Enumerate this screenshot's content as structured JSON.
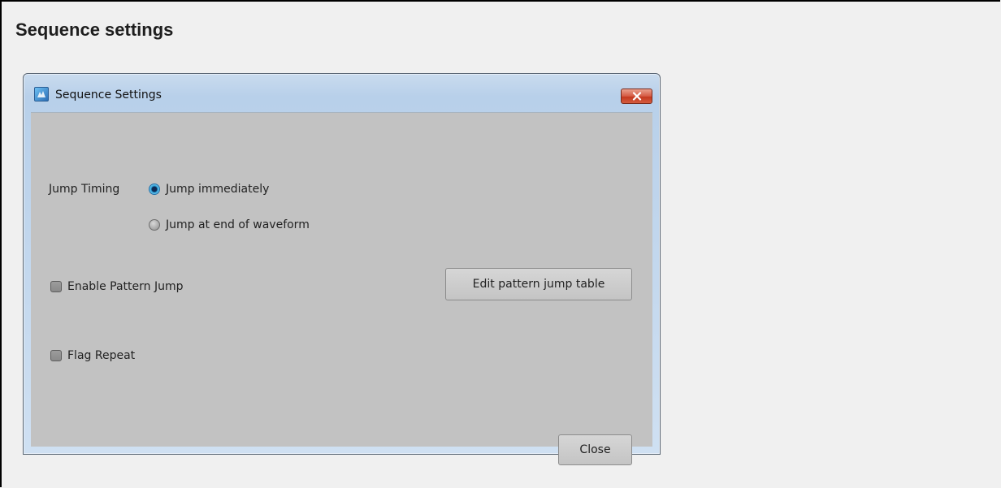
{
  "page": {
    "title": "Sequence settings"
  },
  "window": {
    "title": "Sequence Settings",
    "app_icon": "app-icon",
    "close_icon": "close-x-icon"
  },
  "jump_timing": {
    "label": "Jump Timing",
    "options": [
      {
        "label": "Jump immediately",
        "selected": true
      },
      {
        "label": "Jump at end of waveform",
        "selected": false
      }
    ]
  },
  "pattern_jump": {
    "label": "Enable Pattern Jump",
    "checked": false,
    "edit_button_label": "Edit pattern jump table"
  },
  "flag_repeat": {
    "label": "Flag Repeat",
    "checked": false
  },
  "footer": {
    "close_label": "Close"
  },
  "colors": {
    "client_background": "#c2c2c2",
    "close_button": "#c4391f",
    "radio_selected": "#2aa0d8"
  }
}
